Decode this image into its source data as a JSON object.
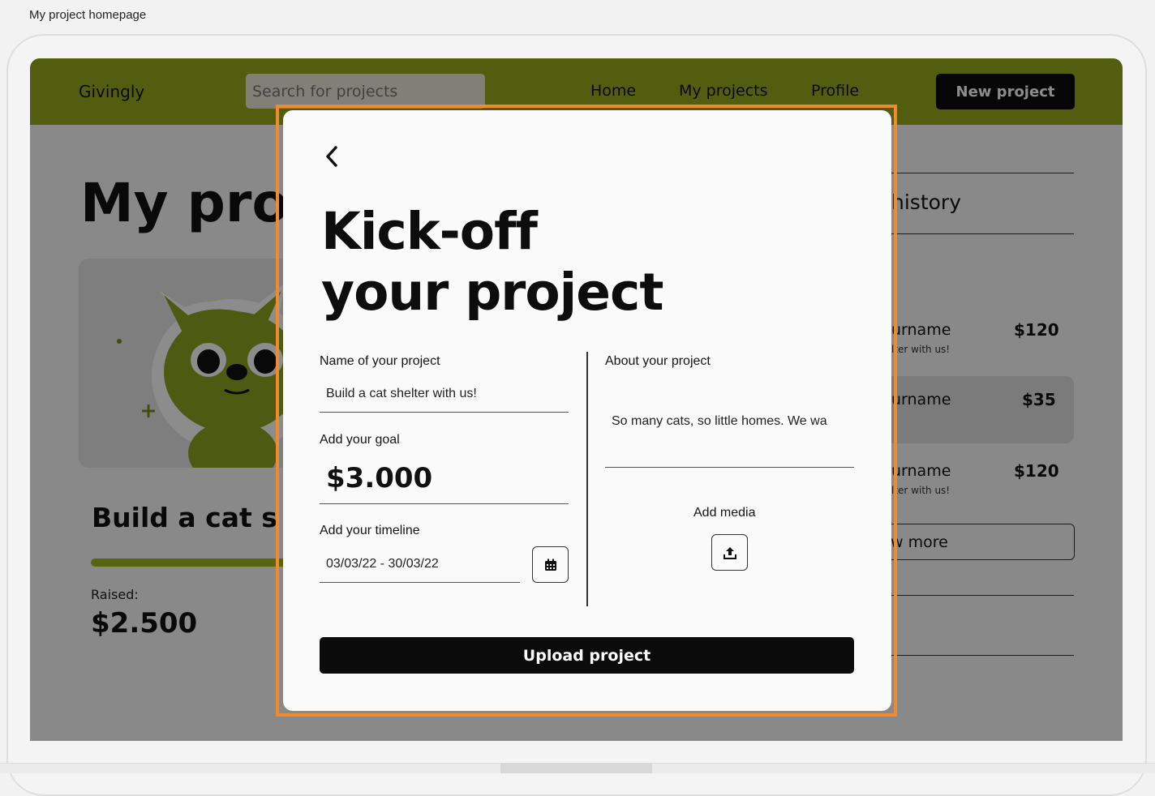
{
  "window": {
    "title": "My project homepage"
  },
  "header": {
    "brand": "Givingly",
    "search_placeholder": "Search for projects",
    "nav": [
      "Home",
      "My projects",
      "Profile"
    ],
    "new_project_label": "New project"
  },
  "background": {
    "page_title_partial": "My proj",
    "project_name_partial": "Build a cat s",
    "raised_label": "Raised:",
    "raised_value": "$2.500",
    "history_partial": "history",
    "donations": [
      {
        "name_partial": "urname",
        "amount": "$120",
        "message_partial": "lter with us!"
      },
      {
        "name_partial": "urname",
        "amount": "$35"
      },
      {
        "name_partial": "urname",
        "amount": "$120",
        "message_partial": "lter with us!"
      }
    ],
    "view_more_partial": "w more"
  },
  "modal": {
    "title_line1": "Kick-off",
    "title_line2": "your project",
    "name_label": "Name of your project",
    "name_value": "Build a cat shelter with us!",
    "goal_label": "Add your goal",
    "goal_value": "$3.000",
    "timeline_label": "Add your timeline",
    "timeline_value": "03/03/22 - 30/03/22",
    "about_label": "About your project",
    "about_value": "So many cats, so little homes. We wa",
    "media_label": "Add media",
    "upload_label": "Upload project",
    "icons": {
      "back": "chevron-left-icon",
      "calendar": "calendar-icon",
      "upload": "upload-icon"
    }
  },
  "colors": {
    "accent": "#95aa1d",
    "highlight_outline": "#f08a2e",
    "button": "#0b0b0b"
  }
}
